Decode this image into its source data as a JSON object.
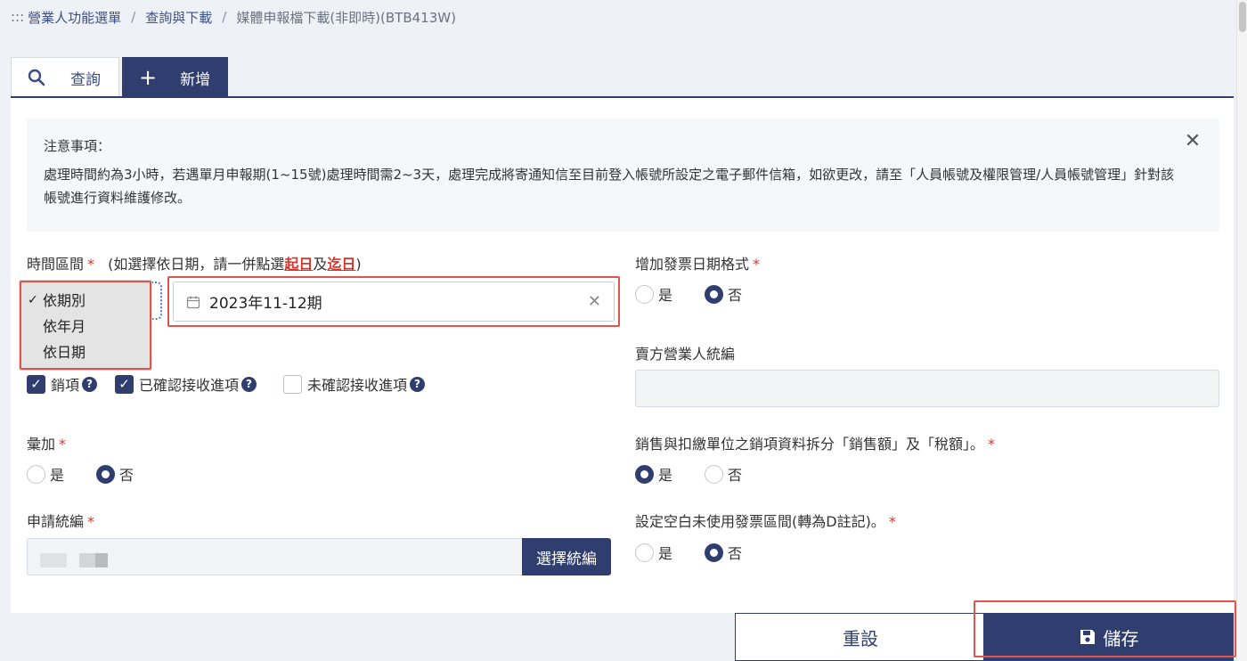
{
  "breadcrumb": {
    "prefix": ":::",
    "items": [
      "營業人功能選單",
      "查詢與下載",
      "媒體申報檔下載(非即時)(BTB413W)"
    ],
    "separator": "/"
  },
  "tabs": [
    {
      "label": "查詢",
      "icon": "search-icon"
    },
    {
      "label": "新增",
      "icon": "plus-icon"
    }
  ],
  "notice": {
    "title": "注意事項：",
    "body": "處理時間約為3小時，若遇單月申報期(1~15號)處理時間需2~3天，處理完成將寄通知信至目前登入帳號所設定之電子郵件信箱，如欲更改，請至「人員帳號及權限管理/人員帳號管理」針對該帳號進行資料維護修改。",
    "close": "✕"
  },
  "time_range": {
    "label": "時間區間",
    "required": "*",
    "hint_pre": "(如選擇依日期，請一併點選",
    "hint_start": "起日",
    "hint_mid": "及",
    "hint_end": "迄日",
    "hint_post": ")",
    "options": [
      "依期別",
      "依年月",
      "依日期"
    ],
    "selected_check": "✓",
    "period_value": "2023年11-12期",
    "clear": "✕"
  },
  "checkboxes": [
    {
      "label": "銷項",
      "checked": true
    },
    {
      "label": "已確認接收進項",
      "checked": true
    },
    {
      "label": "未確認接收進項",
      "checked": false
    }
  ],
  "qmark": "?",
  "merge": {
    "label": "彙加",
    "required": "*",
    "yes": "是",
    "no": "否",
    "selected": "no"
  },
  "apply_id": {
    "label": "申請統編",
    "required": "*",
    "button": "選擇統編"
  },
  "invoice_date_format": {
    "label": "增加發票日期格式",
    "required": "*",
    "yes": "是",
    "no": "否",
    "selected": "no"
  },
  "seller_id": {
    "label": "賣方營業人統編",
    "value": ""
  },
  "split": {
    "label": "銷售與扣繳單位之銷項資料拆分「銷售額」及「稅額」。",
    "required": "*",
    "yes": "是",
    "no": "否",
    "selected": "yes"
  },
  "blank_range": {
    "label": "設定空白未使用發票區間(轉為D註記)。",
    "required": "*",
    "yes": "是",
    "no": "否",
    "selected": "no"
  },
  "actions": {
    "reset": "重設",
    "save": "儲存"
  },
  "colors": {
    "primary": "#2f3e6e",
    "highlight": "#e0554b",
    "required": "#d9342b"
  }
}
